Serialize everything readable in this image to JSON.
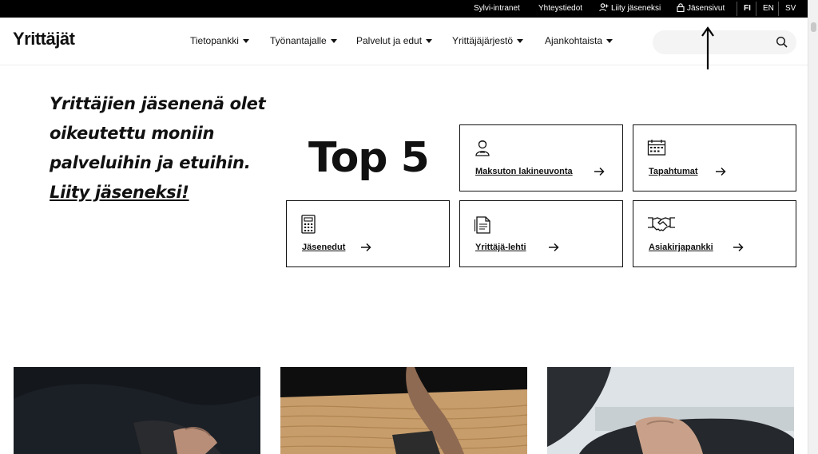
{
  "topbar": {
    "intranet": "Sylvi-intranet",
    "contact": "Yhteystiedot",
    "join": "Liity jäseneksi",
    "member_pages": "Jäsensivut",
    "lang_fi": "FI",
    "lang_en": "EN",
    "lang_sv": "SV"
  },
  "header": {
    "logo": "Yrittäjät",
    "nav": [
      "Tietopankki",
      "Työnantajalle",
      "Palvelut ja edut",
      "Yrittäjäjärjestö",
      "Ajankohtaista"
    ],
    "search_placeholder": ""
  },
  "hero": {
    "line1": "Yrittäjien jäsenenä olet",
    "line2": "oikeutettu moniin",
    "line3": "palveluihin ja etuihin.",
    "link": "Liity jäseneksi!"
  },
  "top5": {
    "title": "Top 5",
    "cards": [
      {
        "label": "Maksuton lakineuvonta",
        "icon": "advisor-icon"
      },
      {
        "label": "Tapahtumat",
        "icon": "calendar-icon"
      },
      {
        "label": "Jäsenedut",
        "icon": "calculator-icon"
      },
      {
        "label": "Yrittäjä-lehti",
        "icon": "document-icon"
      },
      {
        "label": "Asiakirjapankki",
        "icon": "handshake-icon"
      }
    ]
  },
  "colors": {
    "topbar_bg": "#000000",
    "text": "#111111",
    "search_bg": "#f4f4f4"
  }
}
